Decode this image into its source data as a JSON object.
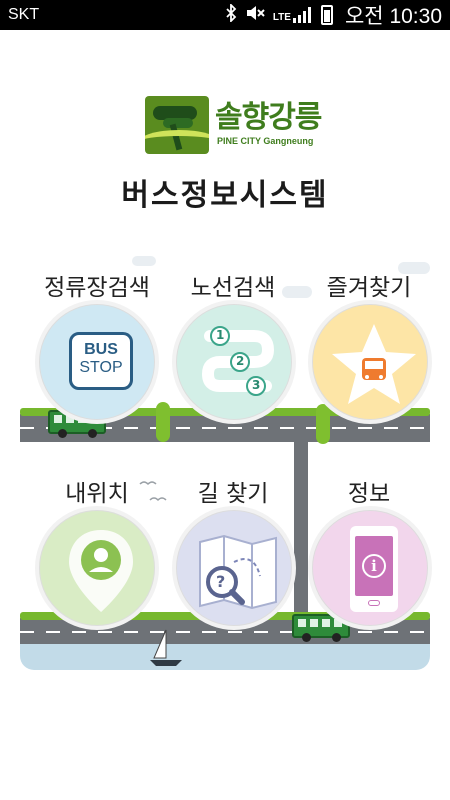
{
  "status_bar": {
    "carrier": "SKT",
    "network": "LTE",
    "time": "오전 10:30",
    "icons": [
      "bluetooth-icon",
      "mute-icon",
      "lte-signal-icon",
      "battery-icon"
    ]
  },
  "logo": {
    "title": "솔향강릉",
    "subtitle": "PINE CITY Gangneung"
  },
  "app_title": "버스정보시스템",
  "menu": [
    {
      "label": "정류장검색",
      "icon": "bus-stop-icon",
      "icon_text_top": "BUS",
      "icon_text_bottom": "STOP",
      "color": "#cfe8f3"
    },
    {
      "label": "노선검색",
      "icon": "route-icon",
      "color": "#d3efe7",
      "steps": [
        "1",
        "2",
        "3"
      ]
    },
    {
      "label": "즐겨찾기",
      "icon": "star-icon",
      "color": "#fde5a6"
    },
    {
      "label": "내위치",
      "icon": "my-location-icon",
      "color": "#d9ecc5"
    },
    {
      "label": "길 찾기",
      "icon": "map-search-icon",
      "color": "#dcdff0",
      "icon_text": "?"
    },
    {
      "label": "정보",
      "icon": "info-phone-icon",
      "color": "#f2d6ec",
      "icon_text": "i"
    }
  ],
  "colors": {
    "road": "#6e7277",
    "grass": "#77b82e",
    "bus": "#2e8b3a",
    "water": "#c2dbe8",
    "brand_green": "#3f7d1d"
  }
}
